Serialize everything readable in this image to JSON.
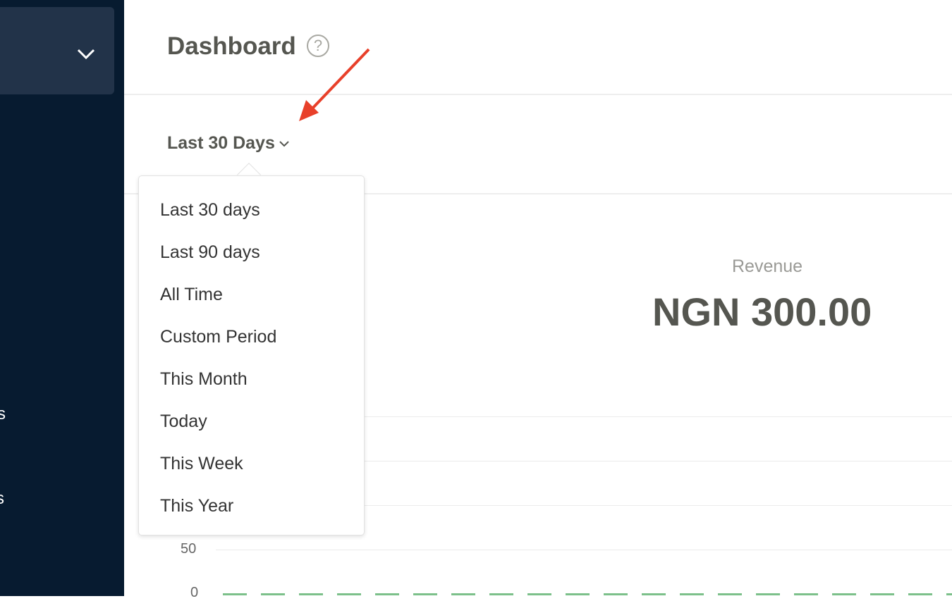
{
  "sidebar": {
    "items": [
      {
        "label": "s"
      },
      {
        "label": "s"
      }
    ]
  },
  "header": {
    "title": "Dashboard",
    "help_icon": "?"
  },
  "filter": {
    "selected": "Last 30 Days"
  },
  "dropdown": {
    "options": [
      "Last 30 days",
      "Last 90 days",
      "All Time",
      "Custom Period",
      "This Month",
      "Today",
      "This Week",
      "This Year"
    ]
  },
  "revenue": {
    "label": "Revenue",
    "value": "NGN 300.00"
  },
  "chart": {
    "ticks": [
      "50",
      "0"
    ],
    "line_color": "#7cc08a"
  },
  "annotation": {
    "arrow_color": "#e8402a"
  }
}
